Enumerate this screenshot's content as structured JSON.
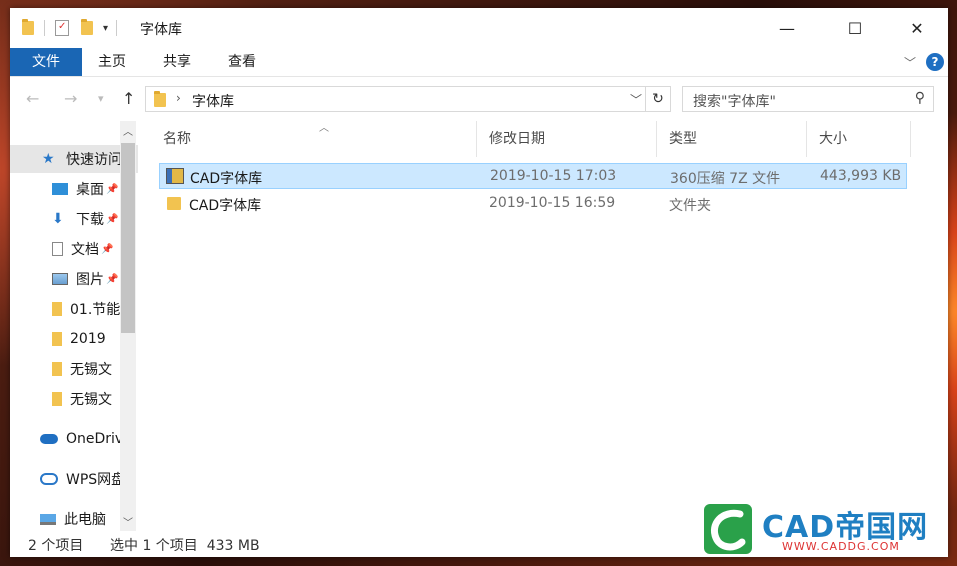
{
  "window": {
    "title": "字体库",
    "minimize_label": "—",
    "maximize_label": "☐",
    "close_label": "✕"
  },
  "ribbon": {
    "tabs": [
      {
        "label": "文件"
      },
      {
        "label": "主页"
      },
      {
        "label": "共享"
      },
      {
        "label": "查看"
      }
    ],
    "help": "?"
  },
  "address": {
    "crumb": "字体库",
    "search_placeholder": "搜索\"字体库\""
  },
  "sidebar": {
    "items": [
      {
        "label": "快速访问",
        "icon": "star-icon"
      },
      {
        "label": "桌面",
        "icon": "desktop-icon"
      },
      {
        "label": "下载",
        "icon": "download-icon"
      },
      {
        "label": "文档",
        "icon": "document-icon"
      },
      {
        "label": "图片",
        "icon": "picture-icon"
      },
      {
        "label": "01.节能",
        "icon": "folder-icon"
      },
      {
        "label": "2019",
        "icon": "folder-icon"
      },
      {
        "label": "无锡文",
        "icon": "folder-icon"
      },
      {
        "label": "无锡文",
        "icon": "folder-icon"
      },
      {
        "label": "OneDrive",
        "icon": "cloud-icon"
      },
      {
        "label": "WPS网盘",
        "icon": "wps-cloud-icon"
      },
      {
        "label": "此电脑",
        "icon": "computer-icon"
      }
    ]
  },
  "table": {
    "columns": [
      "名称",
      "修改日期",
      "类型",
      "大小"
    ],
    "rows": [
      {
        "name": "CAD字体库",
        "date": "2019-10-15 17:03",
        "type": "360压缩 7Z 文件",
        "size": "443,993 KB",
        "icon": "archive-icon",
        "selected": true
      },
      {
        "name": "CAD字体库",
        "date": "2019-10-15 16:59",
        "type": "文件夹",
        "size": "",
        "icon": "folder-icon",
        "selected": false
      }
    ]
  },
  "status": {
    "count": "2 个项目",
    "selection": "选中 1 个项目  433 MB"
  },
  "watermark": {
    "brand": "CAD帝国网",
    "url": "WWW.CADDG.COM"
  },
  "colors": {
    "file_tab": "#1a66b4",
    "selection": "#cce8ff",
    "folder": "#f2c350",
    "watermark_blue": "#1f7fc2",
    "watermark_green": "#2aa14a"
  }
}
